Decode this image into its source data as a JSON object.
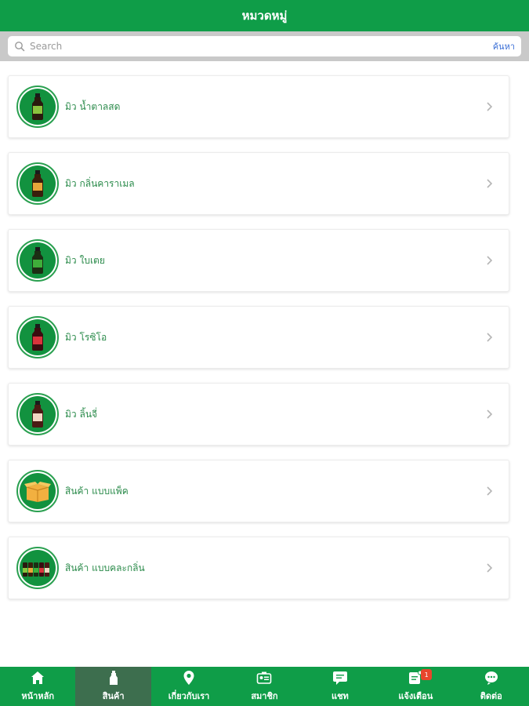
{
  "header": {
    "title": "หมวดหมู่"
  },
  "search": {
    "placeholder": "Search",
    "button_label": "ค้นหา"
  },
  "categories": [
    {
      "label": "มิว น้ำตาลสด",
      "icon": "bottle-icon"
    },
    {
      "label": "มิว กลิ่นคาราเมล",
      "icon": "bottle-icon"
    },
    {
      "label": "มิว ใบเตย",
      "icon": "bottle-icon"
    },
    {
      "label": "มิว โรซิโอ",
      "icon": "bottle-icon"
    },
    {
      "label": "มิว ลิ้นจี่",
      "icon": "bottle-icon"
    },
    {
      "label": "สินค้า แบบแพ็ค",
      "icon": "box-icon"
    },
    {
      "label": "สินค้า แบบคละกลิ่น",
      "icon": "bottles-assorted-icon"
    }
  ],
  "tabs": [
    {
      "label": "หน้าหลัก",
      "icon": "home-icon"
    },
    {
      "label": "สินค้า",
      "icon": "bottle-icon"
    },
    {
      "label": "เกี่ยวกับเรา",
      "icon": "location-pin-icon"
    },
    {
      "label": "สมาชิก",
      "icon": "member-card-icon"
    },
    {
      "label": "แชท",
      "icon": "chat-icon"
    },
    {
      "label": "แจ้งเตือน",
      "icon": "notification-icon",
      "badge": "1"
    },
    {
      "label": "ติดต่อ",
      "icon": "contact-icon"
    }
  ],
  "active_tab": "สินค้า",
  "colors": {
    "brand_green": "#0f9d48",
    "active_tab": "#3d6e4e",
    "label_green": "#2b8b4b",
    "badge_red": "#e8452c",
    "link_blue": "#3b6fd6"
  }
}
